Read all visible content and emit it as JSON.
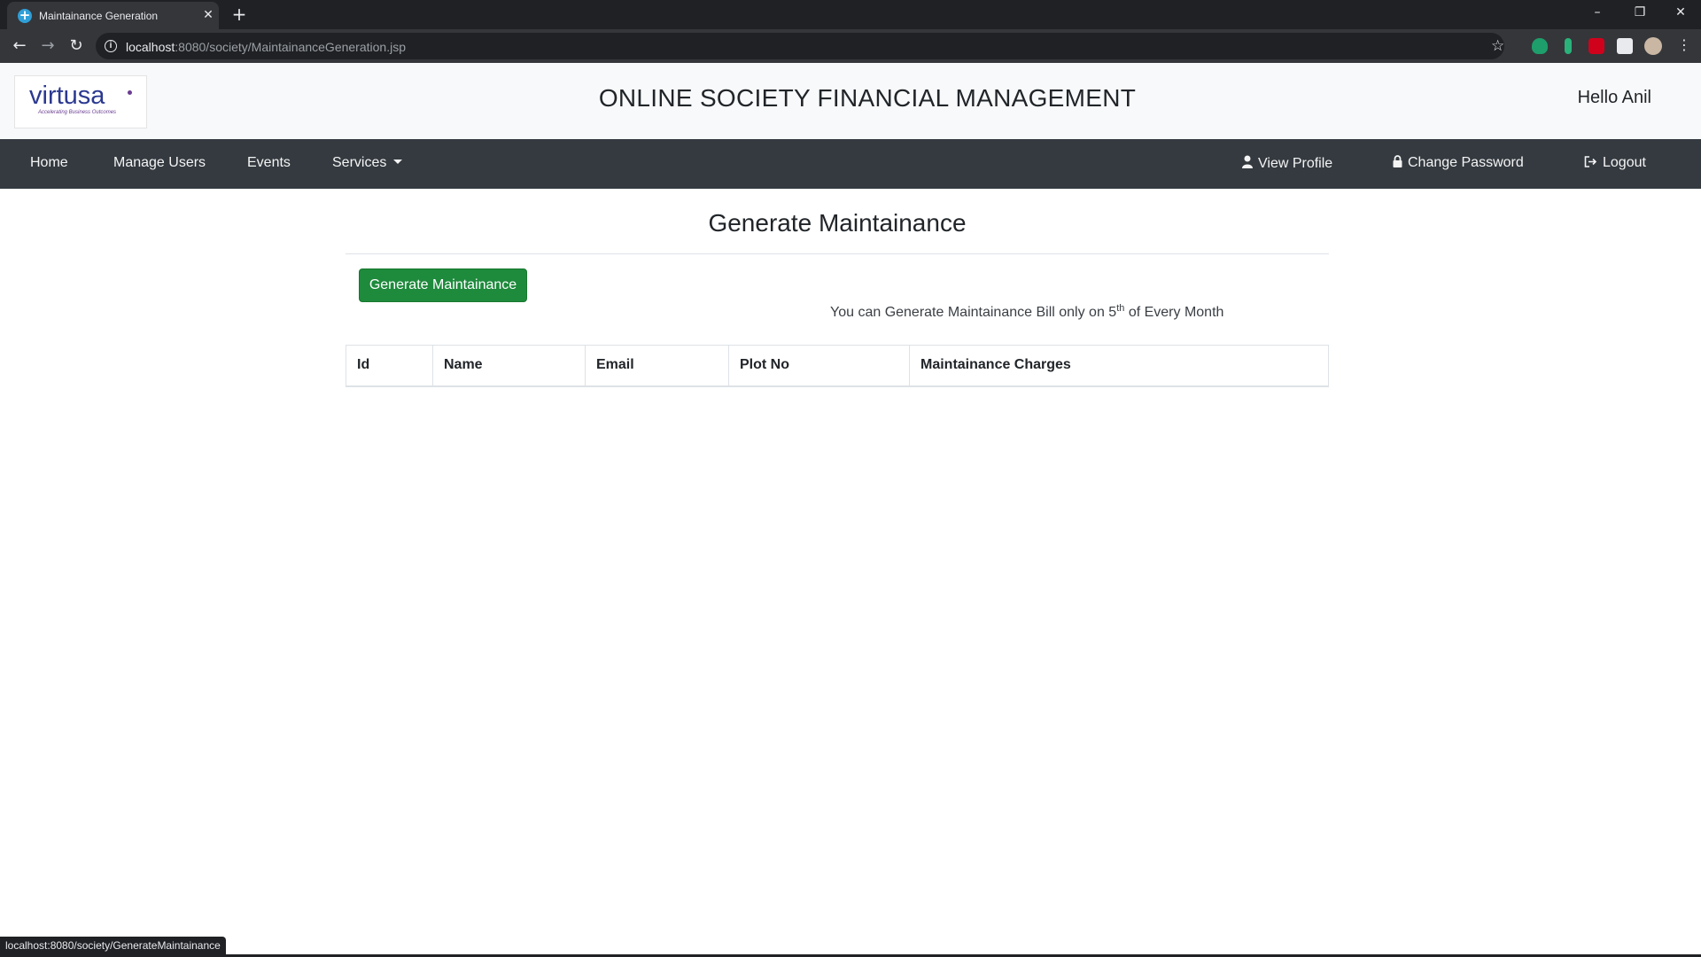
{
  "browser": {
    "tab_title": "Maintainance Generation",
    "url_host": "localhost",
    "url_rest": ":8080/society/MaintainanceGeneration.jsp",
    "status_url": "localhost:8080/society/GenerateMaintainance"
  },
  "header": {
    "logo_text": "virtusa",
    "logo_tagline": "Accelerating Business Outcomes",
    "title": "ONLINE SOCIETY FINANCIAL MANAGEMENT",
    "greeting": "Hello Anil"
  },
  "nav": {
    "home": "Home",
    "manage_users": "Manage Users",
    "events": "Events",
    "services": "Services",
    "view_profile": "View Profile",
    "change_password": "Change Password",
    "logout": "Logout"
  },
  "main": {
    "page_title": "Generate Maintainance",
    "button_label": "Generate Maintainance",
    "note_before": "You can Generate Maintainance Bill only on 5",
    "note_sup": "th",
    "note_after": " of Every Month",
    "table_headers": [
      "Id",
      "Name",
      "Email",
      "Plot No",
      "Maintainance Charges"
    ],
    "table_rows": []
  },
  "colors": {
    "navbar": "#343a40",
    "header_bg": "#f8f9fa",
    "button_green": "#1e8a3c",
    "logo_blue": "#2b3990"
  }
}
